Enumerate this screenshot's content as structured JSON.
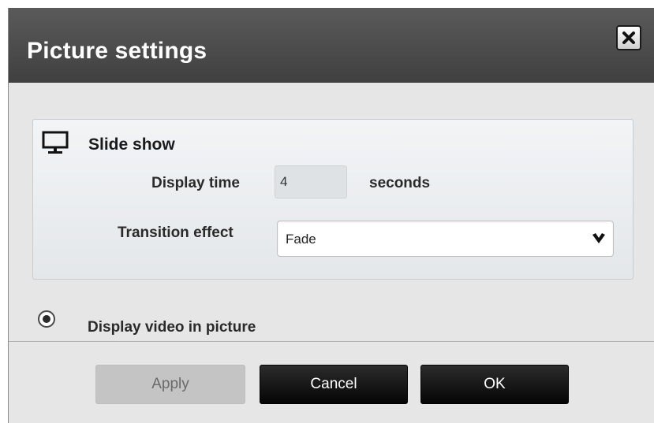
{
  "dialog": {
    "title": "Picture settings",
    "close_icon": "close-icon"
  },
  "slide_show": {
    "title": "Slide show",
    "icon": "monitor-icon",
    "display_time_label": "Display time",
    "display_time_value": "4",
    "display_time_unit": "seconds",
    "transition_label": "Transition effect",
    "transition_value": "Fade",
    "dropdown_icon": "chevron-down-icon"
  },
  "video_option": {
    "label": "Display video in picture",
    "selected": true
  },
  "buttons": {
    "apply": "Apply",
    "cancel": "Cancel",
    "ok": "OK"
  },
  "colors": {
    "title_bar": "#4a4a4a",
    "body": "#e6e6e6",
    "primary_button": "#111111",
    "disabled_button": "#c4c4c4"
  }
}
